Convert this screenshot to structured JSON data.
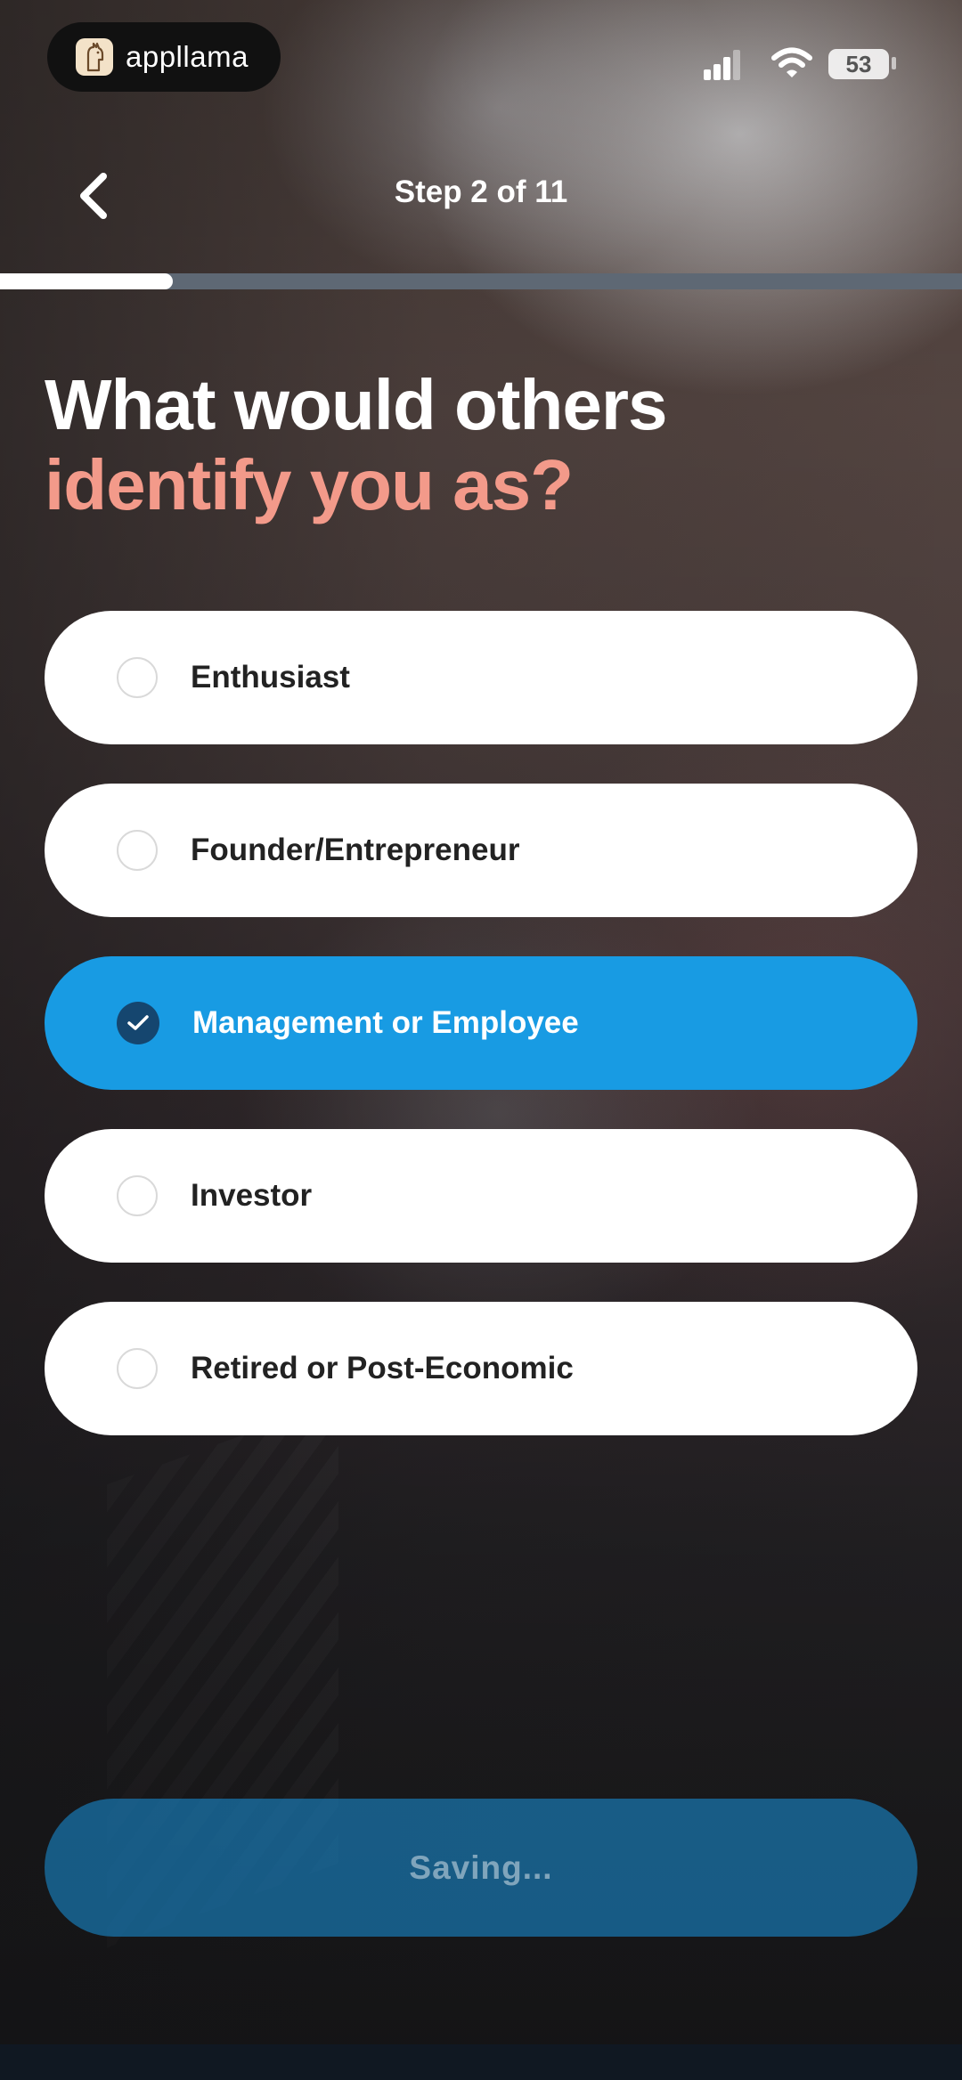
{
  "status_bar": {
    "brand_name": "appllama",
    "battery": "53"
  },
  "header": {
    "step_label": "Step 2 of 11",
    "progress_fraction": 0.18
  },
  "question": {
    "line1": "What would others",
    "line2": "identify you as?"
  },
  "options": [
    {
      "label": "Enthusiast",
      "selected": false
    },
    {
      "label": "Founder/Entrepreneur",
      "selected": false
    },
    {
      "label": "Management or Employee",
      "selected": true
    },
    {
      "label": "Investor",
      "selected": false
    },
    {
      "label": "Retired or Post-Economic",
      "selected": false
    }
  ],
  "save_button": {
    "label": "Saving..."
  },
  "colors": {
    "accent": "#189be3",
    "highlight_text": "#f39a8a",
    "check_fill": "#15466f"
  }
}
